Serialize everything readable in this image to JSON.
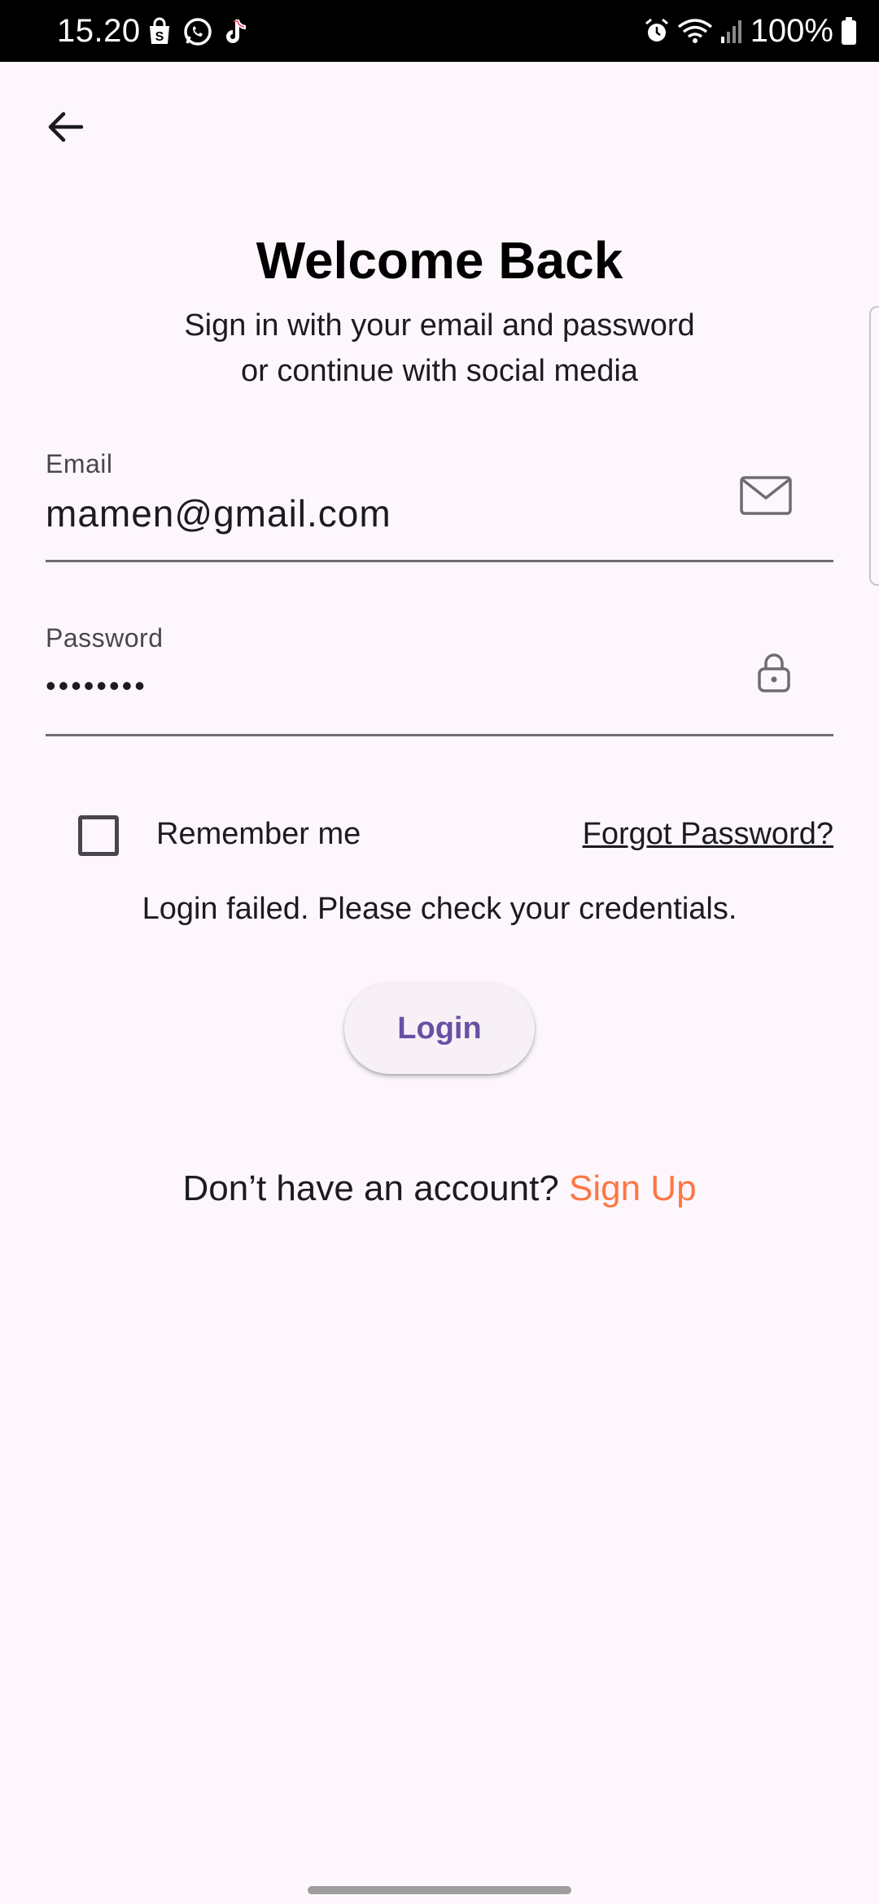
{
  "status_bar": {
    "time": "15.20",
    "battery": "100%",
    "left_icons": [
      "shopping-bag-icon",
      "whatsapp-icon",
      "tiktok-icon"
    ],
    "right_icons": [
      "alarm-icon",
      "wifi-icon",
      "signal-icon",
      "battery-icon"
    ]
  },
  "header": {
    "title": "Welcome Back",
    "subtitle_line1": "Sign in with your email and password",
    "subtitle_line2": "or continue with social media"
  },
  "form": {
    "email": {
      "label": "Email",
      "value": "mamen@gmail.com",
      "icon": "mail-icon"
    },
    "password": {
      "label": "Password",
      "value": "••••••••",
      "icon": "lock-icon"
    },
    "remember_me": {
      "label": "Remember me",
      "checked": false
    },
    "forgot_password": "Forgot Password?",
    "error_message": "Login failed. Please check your credentials.",
    "login_button": "Login"
  },
  "signup": {
    "prompt": "Don’t have an account? ",
    "link": "Sign Up"
  },
  "colors": {
    "background": "#fdf7fd",
    "primary": "#6750a4",
    "accent": "#ff7643",
    "text": "#1c1b1f"
  }
}
